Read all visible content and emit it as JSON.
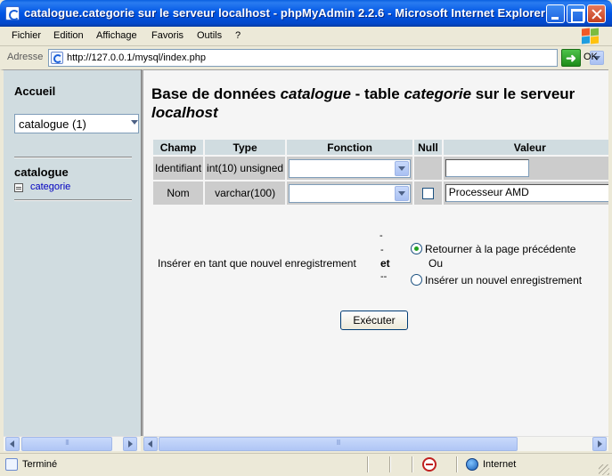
{
  "window": {
    "title": "catalogue.categorie sur le serveur localhost - phpMyAdmin 2.2.6 - Microsoft Internet Explorer"
  },
  "menu": [
    "Fichier",
    "Edition",
    "Affichage",
    "Favoris",
    "Outils",
    "?"
  ],
  "address": {
    "label": "Adresse",
    "url": "http://127.0.0.1/mysql/index.php",
    "go_label": "OK"
  },
  "left": {
    "home": "Accueil",
    "db_select": "catalogue (1)",
    "db_name": "catalogue",
    "table_link": "categorie"
  },
  "main": {
    "heading": {
      "p1": "Base de données ",
      "db": "catalogue",
      "p2": " - table ",
      "table": "categorie",
      "p3": " sur le serveur ",
      "server": "localhost"
    },
    "columns": [
      "Champ",
      "Type",
      "Fonction",
      "Null",
      "Valeur"
    ],
    "rows": [
      {
        "champ": "Identifiant",
        "type": "int(10) unsigned",
        "value": ""
      },
      {
        "champ": "Nom",
        "type": "varchar(100)",
        "value": "Processeur AMD"
      }
    ],
    "insert_label": "Insérer en tant que nouvel enregistrement",
    "dash1": "-",
    "dash2": "-",
    "et": "et",
    "dash3": "--",
    "radio1": "Retourner à la page précédente",
    "ou": "Ou",
    "radio2": "Insérer un nouvel enregistrement",
    "submit": "Exécuter"
  },
  "status": {
    "text": "Terminé",
    "zone": "Internet"
  }
}
